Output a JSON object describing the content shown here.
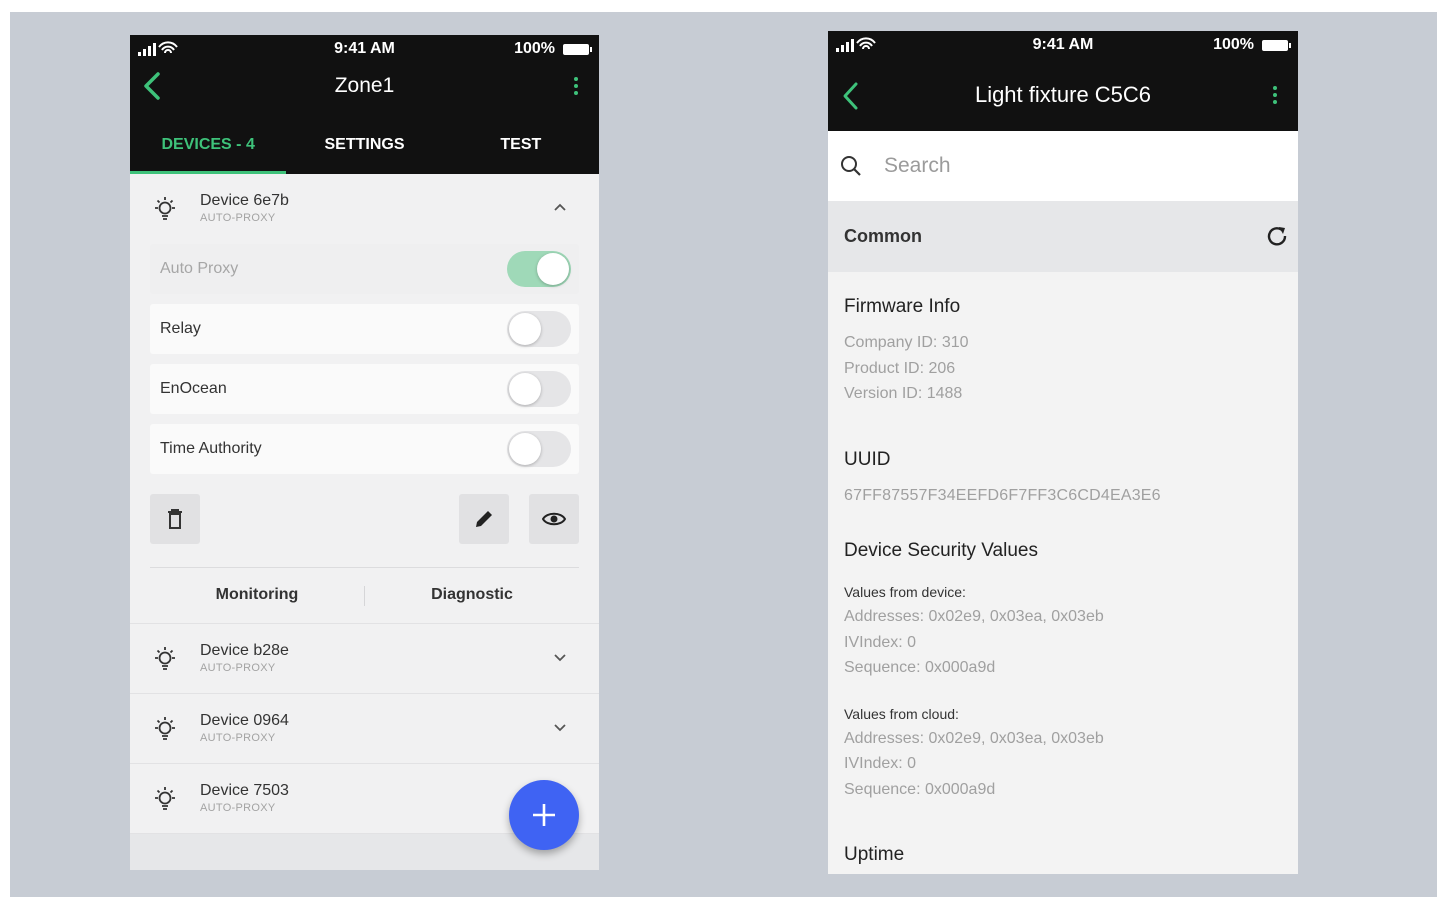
{
  "colors": {
    "accent": "#3ec27a",
    "fab": "#3f63f3",
    "header": "#111111"
  },
  "phone1": {
    "status": {
      "time": "9:41 AM",
      "battery": "100%"
    },
    "title": "Zone1",
    "tabs": [
      {
        "label": "DEVICES - 4",
        "active": true
      },
      {
        "label": "SETTINGS",
        "active": false
      },
      {
        "label": "TEST",
        "active": false
      }
    ],
    "devices": [
      {
        "name": "Device 6e7b",
        "sub": "AUTO-PROXY",
        "expanded": true
      },
      {
        "name": "Device b28e",
        "sub": "AUTO-PROXY",
        "expanded": false
      },
      {
        "name": "Device 0964",
        "sub": "AUTO-PROXY",
        "expanded": false
      },
      {
        "name": "Device 7503",
        "sub": "AUTO-PROXY",
        "expanded": false
      }
    ],
    "toggles": [
      {
        "label": "Auto Proxy",
        "on": true,
        "disabled": true
      },
      {
        "label": "Relay",
        "on": false,
        "disabled": false
      },
      {
        "label": "EnOcean",
        "on": false,
        "disabled": false
      },
      {
        "label": "Time Authority",
        "on": false,
        "disabled": false
      }
    ],
    "subtabs": [
      "Monitoring",
      "Diagnostic"
    ],
    "icons": [
      "back-chevron-icon",
      "kebab-menu-icon",
      "bulb-icon",
      "trash-icon",
      "pencil-icon",
      "eye-icon",
      "plus-icon",
      "chevron-up-icon",
      "chevron-down-icon"
    ]
  },
  "phone2": {
    "status": {
      "time": "9:41 AM",
      "battery": "100%"
    },
    "title": "Light fixture C5C6",
    "search_placeholder": "Search",
    "section": "Common",
    "firmware": {
      "heading": "Firmware Info",
      "company": "Company ID: 310",
      "product": "Product ID: 206",
      "version": "Version ID: 1488"
    },
    "uuid": {
      "heading": "UUID",
      "value": "67FF87557F34EEFD6F7FF3C6CD4EA3E6"
    },
    "security": {
      "heading": "Device Security Values",
      "device_label": "Values from device:",
      "device_addresses": "Addresses: 0x02e9, 0x03ea, 0x03eb",
      "device_ivindex": "IVIndex: 0",
      "device_sequence": "Sequence: 0x000a9d",
      "cloud_label": "Values from cloud:",
      "cloud_addresses": "Addresses: 0x02e9, 0x03ea, 0x03eb",
      "cloud_ivindex": "IVIndex: 0",
      "cloud_sequence": "Sequence: 0x000a9d"
    },
    "uptime_heading": "Uptime"
  }
}
